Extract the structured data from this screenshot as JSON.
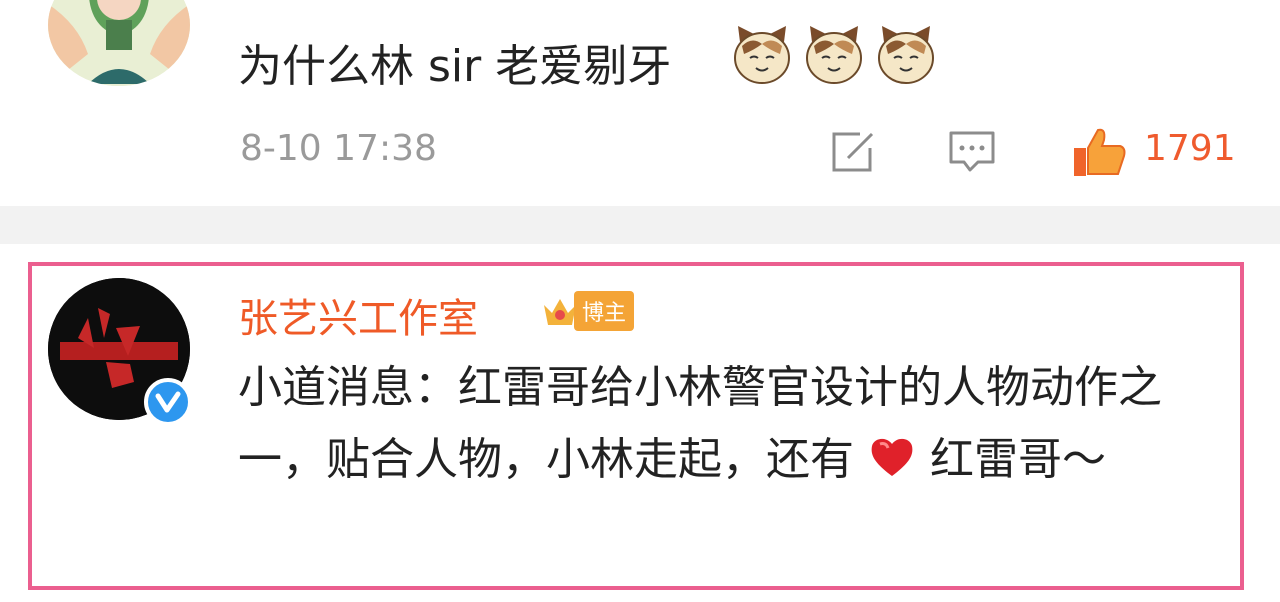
{
  "comment1": {
    "text": "为什么林 sir 老爱剔牙",
    "emoji": [
      "cat-emoji",
      "cat-emoji",
      "cat-emoji"
    ],
    "time": "8-10 17:38",
    "likes": "1791",
    "colors": {
      "like": "#ef5b2e",
      "meta": "#9a9a9a"
    }
  },
  "comment2": {
    "author": "张艺兴工作室",
    "badge_label": "博主",
    "verified": true,
    "text_part1": "小道消息：红雷哥给小林警官设计的人物动作之一，贴合人物，小林走起，还有",
    "heart_icon": "heart-emoji",
    "text_part2": "红雷哥～",
    "colors": {
      "name": "#ef5a27",
      "highlight_border": "#eb5f8f",
      "badge": "#f4a436"
    }
  }
}
